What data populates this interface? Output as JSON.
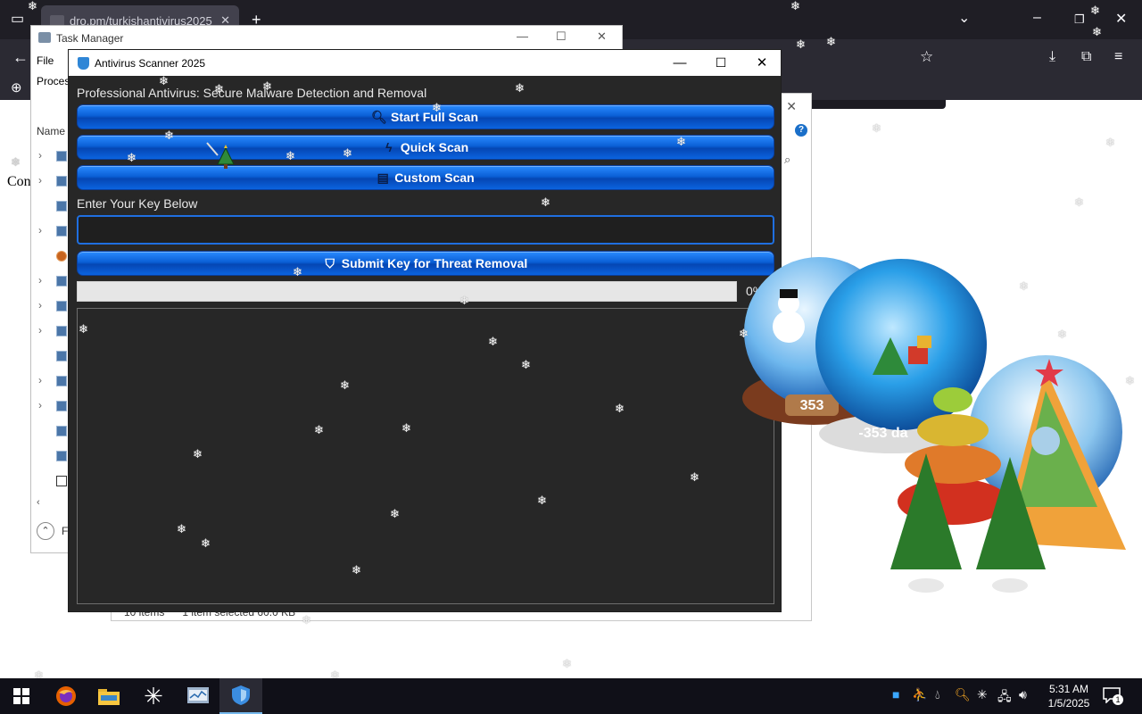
{
  "browser": {
    "tab_title": "dro.pm/turkishantivirus2025",
    "page_text": "Con"
  },
  "explorer": {
    "status_items": "10 items",
    "status_selected": "1 item selected  60.0 KB"
  },
  "task_manager": {
    "title": "Task Manager",
    "menu_file": "File",
    "tab_processes": "Proces",
    "column_name": "Name",
    "fewer_details": "F"
  },
  "scanner": {
    "title": "Antivirus Scanner 2025",
    "headline": "Professional Antivirus: Secure Malware Detection and Removal",
    "buttons": {
      "full_scan": "Start Full Scan",
      "quick_scan": "Quick Scan",
      "custom_scan": "Custom Scan",
      "submit_key": "Submit Key for Threat Removal"
    },
    "key_label": "Enter Your Key Below",
    "key_value": "",
    "progress_value": 0,
    "progress_label": "0%",
    "log_text": ""
  },
  "decoration": {
    "counter_a": "353",
    "counter_b": "-353 da"
  },
  "taskbar": {
    "time": "5:31 AM",
    "date": "1/5/2025",
    "notification_count": "1"
  },
  "colors": {
    "accent_blue": "#0a5fd6",
    "window_bg": "#272727",
    "taskbar_bg": "#101018"
  }
}
